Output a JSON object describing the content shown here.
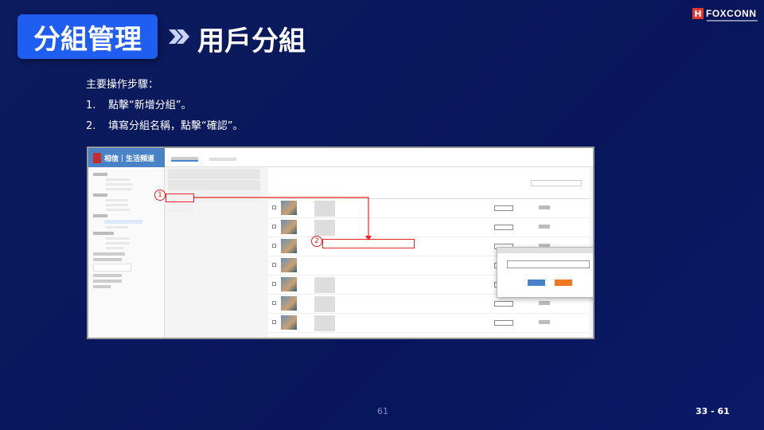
{
  "header": {
    "title": "分組管理",
    "subtitle": "用戶分組"
  },
  "logo": {
    "text": "FOXCONN",
    "mark": "H"
  },
  "instructions": {
    "heading": "主要操作步驟：",
    "steps": [
      {
        "num": "1.",
        "text": "點擊“新增分組”。"
      },
      {
        "num": "2.",
        "text": "填寫分組名稱，點擊“確認”。"
      }
    ]
  },
  "screenshot": {
    "app_name": "相信｜生活頻道",
    "markers": [
      "1",
      "2"
    ],
    "colors": {
      "accent": "#4a82c8",
      "highlight": "#e22222",
      "cancel": "#f07820"
    }
  },
  "footer": {
    "page": "61",
    "section": "33 - 61"
  },
  "colors": {
    "background": "#0b1c5e",
    "title_box": "#1f5ef0",
    "logo_red": "#e03a2e"
  }
}
